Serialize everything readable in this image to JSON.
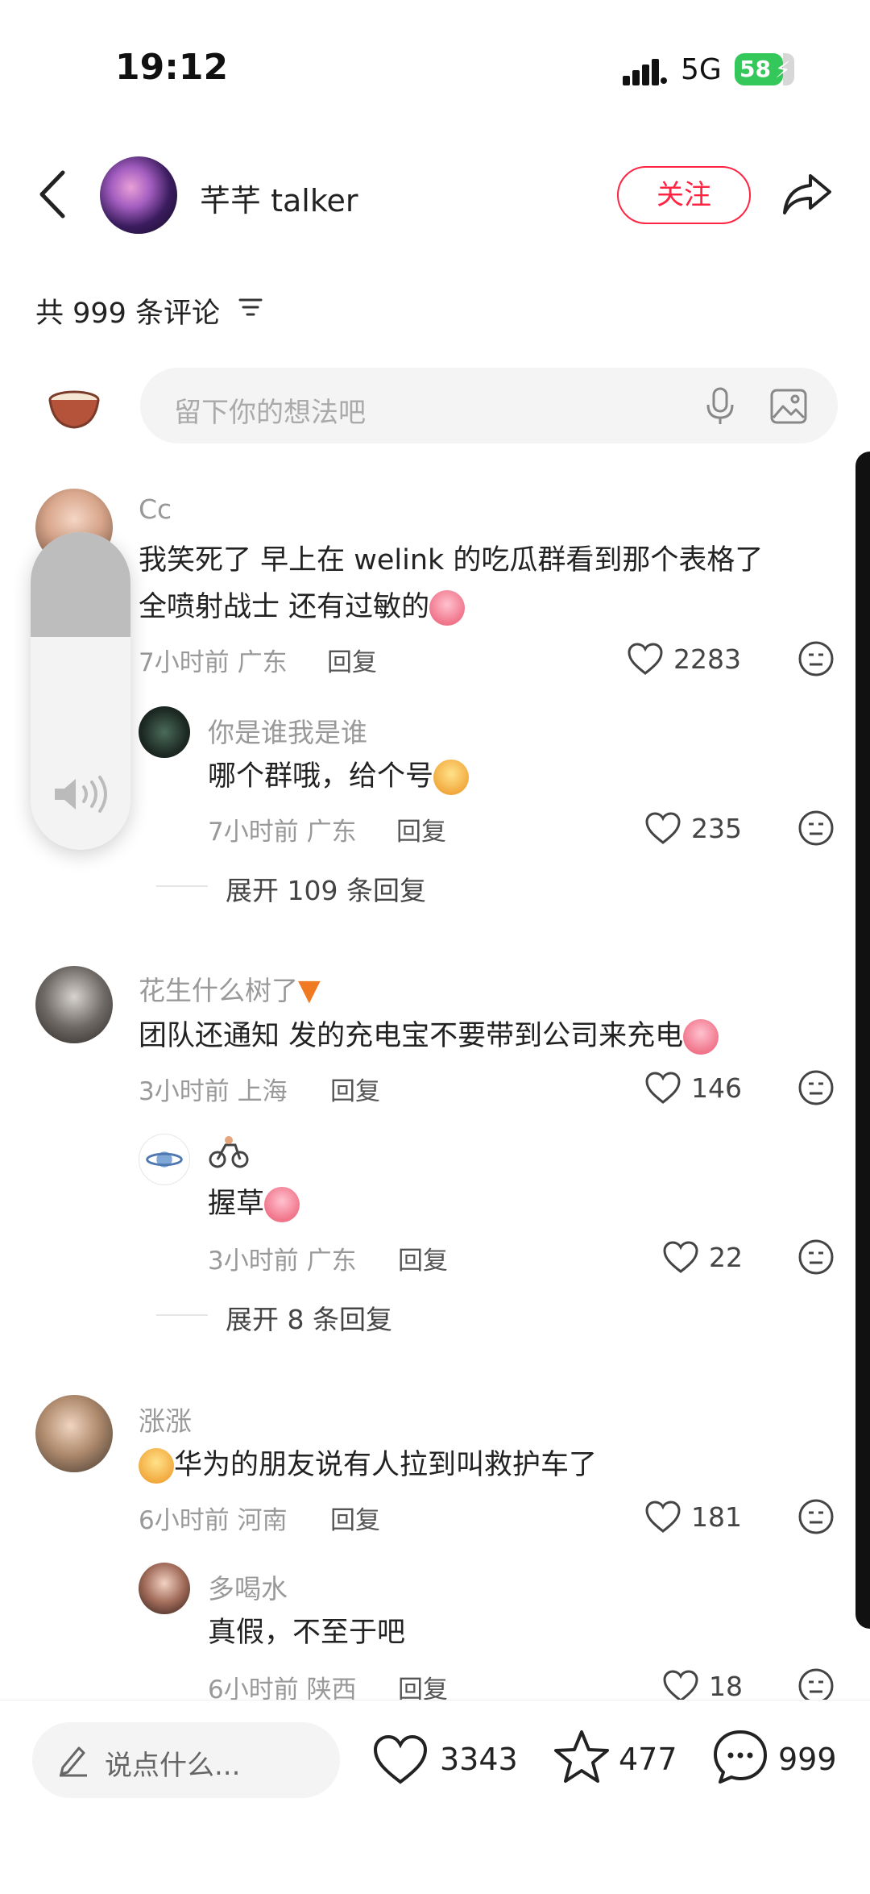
{
  "status": {
    "time": "19:12",
    "network": "5G",
    "battery": "58"
  },
  "header": {
    "author": "芊芊 talker",
    "follow_label": "关注"
  },
  "comments_header": {
    "count_label": "共 999 条评论"
  },
  "input": {
    "placeholder": "留下你的想法吧"
  },
  "comments": [
    {
      "user": "Cc",
      "text_1": "我笑死了  早上在 welink 的吃瓜群看到那个表格了",
      "text_2": "全喷射战士 还有过敏的",
      "meta": "7小时前 广东",
      "reply": "回复",
      "likes": "2283",
      "sub": {
        "user": "你是谁我是谁",
        "text": "哪个群哦，给个号",
        "meta": "7小时前 广东",
        "reply": "回复",
        "likes": "235"
      },
      "expand": "展开 109 条回复"
    },
    {
      "user": "花生什么树了",
      "text_1": "团队还通知 发的充电宝不要带到公司来充电",
      "meta": "3小时前 上海",
      "reply": "回复",
      "likes": "146",
      "sub": {
        "user": "",
        "text": "握草",
        "meta": "3小时前 广东",
        "reply": "回复",
        "likes": "22"
      },
      "expand": "展开 8 条回复"
    },
    {
      "user": "涨涨",
      "text_1": "华为的朋友说有人拉到叫救护车了",
      "meta": "6小时前 河南",
      "reply": "回复",
      "likes": "181",
      "sub": {
        "user": "多喝水",
        "text": "真假，不至于吧",
        "meta": "6小时前 陕西",
        "reply": "回复",
        "likes": "18"
      }
    }
  ],
  "bottom": {
    "say_placeholder": "说点什么...",
    "likes": "3343",
    "stars": "477",
    "comments": "999"
  },
  "colors": {
    "accent": "#ff2442",
    "battery": "#34c759"
  }
}
